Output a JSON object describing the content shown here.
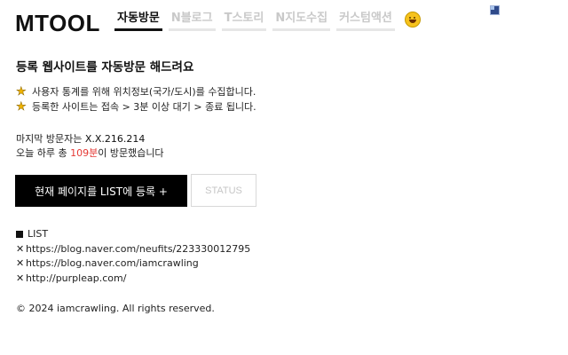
{
  "header": {
    "logo": "MTOOL",
    "tabs": [
      {
        "label": "자동방문",
        "active": true
      },
      {
        "label": "N블로그",
        "active": false
      },
      {
        "label": "T스토리",
        "active": false
      },
      {
        "label": "N지도수집",
        "active": false
      },
      {
        "label": "커스텀액션",
        "active": false
      }
    ],
    "emoji_icon": "grinning-face-icon"
  },
  "main": {
    "heading": "등록 웹사이트를 자동방문 해드려요",
    "notes": [
      "사용자 통계를 위해 위치정보(국가/도시)를 수집합니다.",
      "등록한 사이트는 접속 > 3분 이상 대기 > 종료 됩니다."
    ],
    "last_visitor_label": "마지막 방문자는 ",
    "last_visitor_ip": "X.X.216.214",
    "today_prefix": "오늘 하루 총 ",
    "today_count": "109분",
    "today_suffix": "이 방문했습니다",
    "register_button": "현재 페이지를 LIST에 등록 +",
    "status_button": "STATUS",
    "list_title": "LIST",
    "list_items": [
      "https://blog.naver.com/neufits/223330012795",
      "https://blog.naver.com/iamcrawling",
      "http://purpleap.com/"
    ]
  },
  "footer": {
    "copyright": "© 2024 iamcrawling. All rights reserved."
  },
  "colors": {
    "accent": "#000000",
    "count_highlight": "#e53935",
    "inactive_tab": "#c9c9c9",
    "star": "#f0b400"
  }
}
